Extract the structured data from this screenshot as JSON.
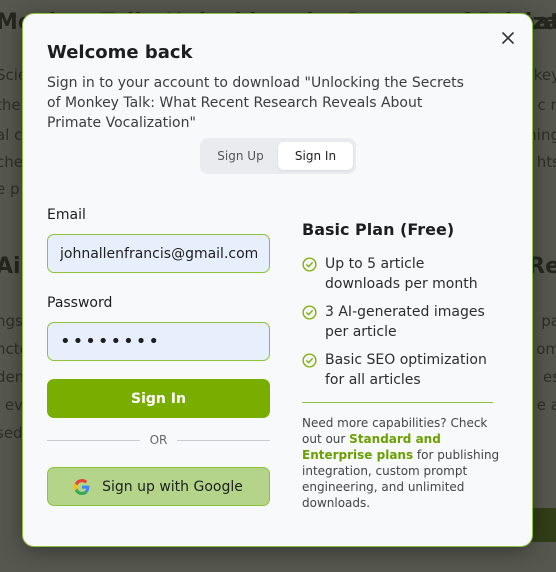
{
  "modal": {
    "title": "Welcome back",
    "subtitle": "Sign in to your account to download \"Unlocking the Secrets of Monkey Talk: What Recent Research Reveals About Primate Vocalization\"",
    "close_icon": "close-icon",
    "tabs": [
      {
        "label": "Sign Up",
        "active": false
      },
      {
        "label": "Sign In",
        "active": true
      }
    ]
  },
  "form": {
    "email_label": "Email",
    "email_value": "johnallenfrancis@gmail.com",
    "password_label": "Password",
    "password_value": "••••••••",
    "submit_label": "Sign In",
    "divider_text": "OR",
    "google_label": "Sign up with Google",
    "google_icon": "google-icon"
  },
  "plan": {
    "title": "Basic Plan (Free)",
    "features": [
      "Up to 5 article downloads per month",
      "3 AI-generated images per article",
      "Basic SEO optimization for all articles"
    ],
    "check_icon": "check-circle-icon",
    "more_text_before": "Need more capabilities? Check out our ",
    "more_link": "Standard and Enterprise plans",
    "more_text_after": " for publishing integration, custom prompt engineering, and unlimited downloads."
  },
  "colors": {
    "accent": "#79ad00",
    "accent_border": "#8fc23a",
    "google_button_bg": "#b4d48a",
    "modal_bg": "#f7f9fb"
  }
}
